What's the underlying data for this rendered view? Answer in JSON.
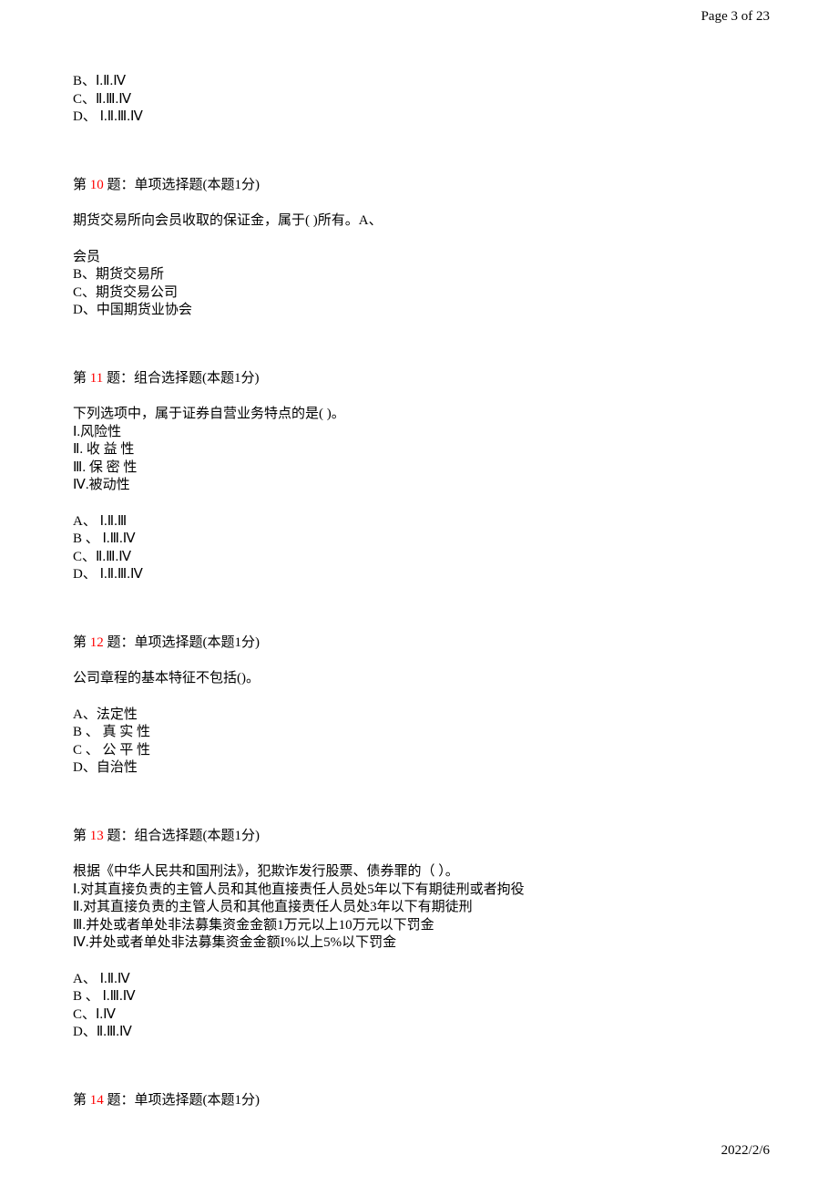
{
  "header": {
    "page_label": "Page 3 of 23"
  },
  "footer": {
    "date": "2022/2/6"
  },
  "prev_tail": {
    "b": "B、Ⅰ.Ⅱ.Ⅳ",
    "c": "C、Ⅱ.Ⅲ.Ⅳ",
    "d": "D、 Ⅰ.Ⅱ.Ⅲ.Ⅳ"
  },
  "q10": {
    "prefix": "第 ",
    "num": "10",
    "suffix": " 题：单项选择题(本题1分)",
    "stem": "期货交易所向会员收取的保证金，属于(  )所有。A、",
    "a": "会员",
    "b": "B、期货交易所",
    "c": "C、期货交易公司",
    "d": "D、中国期货业协会"
  },
  "q11": {
    "prefix": "第 ",
    "num": "11",
    "suffix": " 题：组合选择题(本题1分)",
    "stem": "下列选项中，属于证券自营业务特点的是( )。",
    "i": "Ⅰ.风险性",
    "ii": "Ⅱ. 收 益 性",
    "iii": "Ⅲ. 保 密 性",
    "iv": "Ⅳ.被动性",
    "a": "A、 Ⅰ.Ⅱ.Ⅲ",
    "b": "B 、 Ⅰ.Ⅲ.Ⅳ",
    "c": "C、Ⅱ.Ⅲ.Ⅳ",
    "d": "D、 Ⅰ.Ⅱ.Ⅲ.Ⅳ"
  },
  "q12": {
    "prefix": "第  ",
    "num": "12",
    "suffix": " 题：单项选择题(本题1分)",
    "stem": "公司章程的基本特征不包括()。",
    "a": "A、法定性",
    "b": "B 、 真 实 性",
    "c": "C 、 公 平 性",
    "d": "D、自治性"
  },
  "q13": {
    "prefix": "第 ",
    "num": "13",
    "suffix": " 题：组合选择题(本题1分)",
    "stem": "根据《中华人民共和国刑法》，犯欺诈发行股票、债券罪的（        ）。",
    "i": "Ⅰ.对其直接负责的主管人员和其他直接责任人员处5年以下有期徒刑或者拘役",
    "ii": "Ⅱ.对其直接负责的主管人员和其他直接责任人员处3年以下有期徒刑",
    "iii": "Ⅲ.并处或者单处非法募集资金金额1万元以上10万元以下罚金",
    "iv": "Ⅳ.并处或者单处非法募集资金金额I%以上5%以下罚金",
    "a": "A、 Ⅰ.Ⅱ.Ⅳ",
    "b": "B 、 Ⅰ.Ⅲ.Ⅳ",
    "c": "C、Ⅰ.Ⅳ",
    "d": "D、Ⅱ.Ⅲ.Ⅳ"
  },
  "q14": {
    "prefix": "第 ",
    "num": "14",
    "suffix": " 题：单项选择题(本题1分)"
  }
}
